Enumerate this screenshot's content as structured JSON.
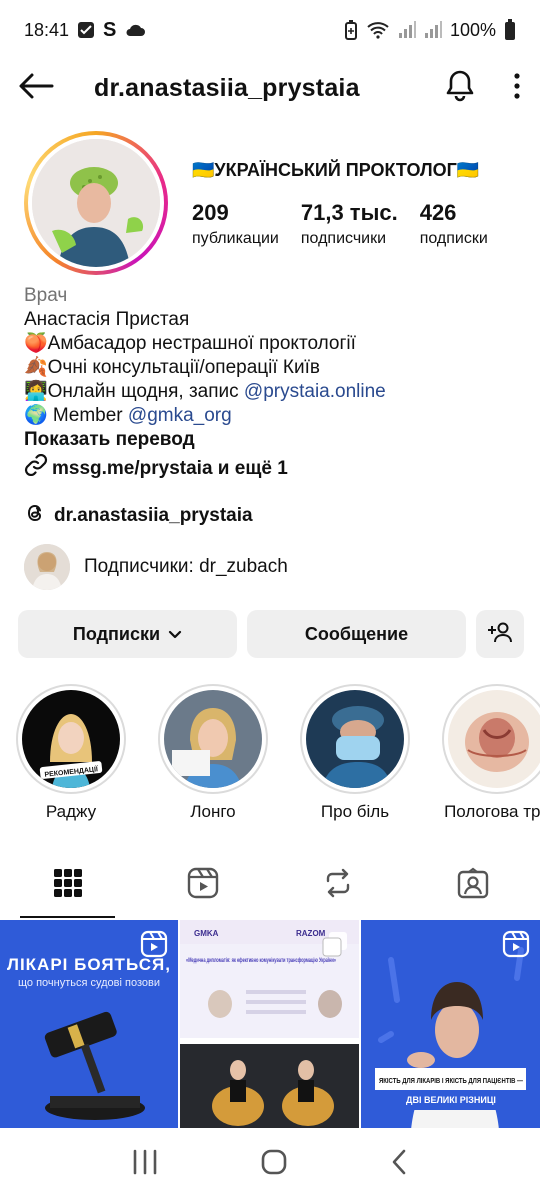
{
  "status_bar": {
    "time": "18:41",
    "s_label": "S",
    "battery": "100%",
    "icons": [
      "check-square-icon",
      "s-app-icon",
      "cloud-icon",
      "battery-saver-icon",
      "wifi-icon",
      "signal-icon",
      "signal-icon"
    ]
  },
  "header": {
    "username": "dr.anastasiia_prystaia",
    "icons": [
      "back-arrow-icon",
      "bell-icon",
      "more-vertical-icon"
    ]
  },
  "profile": {
    "display_name": "🇺🇦УКРАЇНСЬКИЙ ПРОКТОЛОГ🇺🇦",
    "stats": [
      {
        "value": "209",
        "label": "публикации"
      },
      {
        "value": "71,3 тыс.",
        "label": "подписчики"
      },
      {
        "value": "426",
        "label": "подписки"
      }
    ]
  },
  "bio": {
    "category": "Врач",
    "name_line": "Анастасія Пристая",
    "line1": "🍑Амбасадор нестрашної проктології",
    "line2": "🍂Очні консультації/операції Київ",
    "line3_prefix": "👩‍💻Онлайн щодня, запис ",
    "line3_link": "@prystaia.online",
    "line4_prefix": "🌍 Member ",
    "line4_link": "@gmka_org",
    "translate": "Показать перевод",
    "website": "mssg.me/prystaia и ещё 1"
  },
  "threads": {
    "handle": "dr.anastasiia_prystaia"
  },
  "followers_preview": {
    "text": "Подписчики: dr_zubach"
  },
  "buttons": {
    "following": "Подписки",
    "message": "Сообщение"
  },
  "highlights": [
    {
      "label": "Раджу",
      "sticker": "РЕКОМЕНДАЦІЇ"
    },
    {
      "label": "Лонго"
    },
    {
      "label": "Про біль"
    },
    {
      "label": "Пологова тра"
    }
  ],
  "tabs": [
    "grid-icon",
    "reels-icon",
    "reposts-icon",
    "tagged-icon"
  ],
  "posts": [
    {
      "headline": "ЛІКАРІ БОЯТЬСЯ,",
      "sub": "що почнуться судові позови"
    },
    {
      "logo_left": "GMKA",
      "logo_right": "RAZOM",
      "title": "«Медична дипломатія: як ефективно комунікувати трансформацію України»"
    },
    {
      "caption_top": "ЯКІСТЬ ДЛЯ ЛІКАРІВ І ЯКІСТЬ ДЛЯ ПАЦІЄНТІВ —",
      "caption_bottom": "ДВІ ВЕЛИКІ РІЗНИЦІ"
    }
  ],
  "colors": {
    "link": "#2a4a8f",
    "button_bg": "#efefef",
    "post_blue": "#2f5bd8"
  }
}
